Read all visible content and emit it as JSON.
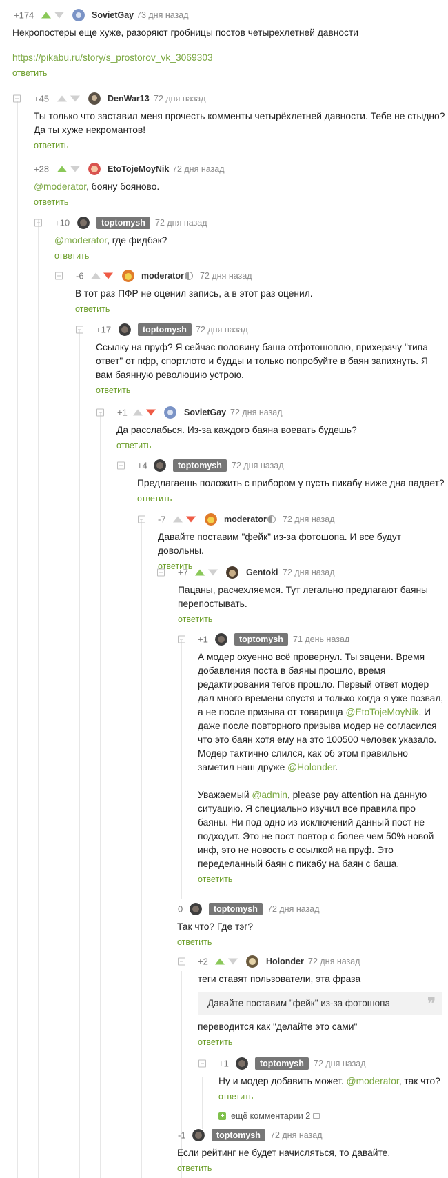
{
  "reply_label": "ответить",
  "comments": [
    {
      "id": "c1",
      "rating": "+174",
      "vote": "up",
      "user": "SovietGay",
      "time": "73 дня назад",
      "text_parts": [
        {
          "t": "Некропостеры еще хуже, разоряют гробницы постов четырехлетней давности"
        }
      ],
      "link": "https://pikabu.ru/story/s_prostorov_vk_3069303"
    },
    {
      "id": "c2",
      "rating": "+45",
      "vote": "none",
      "user": "DenWar13",
      "time": "72 дня назад",
      "text": "Ты только что заставил меня прочесть комменты четырёхлетней давности. Тебе не стыдно? Да ты хуже некромантов!"
    },
    {
      "id": "c3",
      "rating": "+28",
      "vote": "up",
      "user": "EtoTojeMoyNik",
      "time": "72 дня назад",
      "mention": "@moderator",
      "text_after": ",  бояну бояново."
    },
    {
      "id": "c4",
      "rating": "+10",
      "vote": "none",
      "user": "toptomysh",
      "time": "72 дня назад",
      "mention": "@moderator",
      "text_after": ", где фидбэк?"
    },
    {
      "id": "c5",
      "rating": "-6",
      "vote": "down",
      "user": "moderator",
      "time": "72 дня назад",
      "text": "В тот раз ПФР не оценил запись, а в этот раз оценил."
    },
    {
      "id": "c6",
      "rating": "+17",
      "vote": "none",
      "user": "toptomysh",
      "time": "72 дня назад",
      "text": "Ссылку на пруф? Я сейчас половину баша отфотошоплю, прихерачу \"типа ответ\" от пфр, спортлото и будды и только попробуйте в баян запихнуть. Я вам баянную революцию устрою."
    },
    {
      "id": "c7",
      "rating": "+1",
      "vote": "down",
      "user": "SovietGay",
      "time": "72 дня назад",
      "text": "Да расслабься. Из-за каждого баяна воевать будешь?"
    },
    {
      "id": "c8",
      "rating": "+4",
      "vote": "none",
      "user": "toptomysh",
      "time": "72 дня назад",
      "text": "Предлагаешь положить с прибором у пусть пикабу ниже дна падает?"
    },
    {
      "id": "c9",
      "rating": "-7",
      "vote": "down",
      "user": "moderator",
      "time": "72 дня назад",
      "text": "Давайте поставим \"фейк\" из-за фотошопа. И все будут довольны."
    },
    {
      "id": "c10",
      "rating": "+7",
      "vote": "up",
      "user": "Gentoki",
      "time": "72 дня назад",
      "text": "Пацаны, расчехляемся. Тут легально предлагают баяны перепостывать."
    },
    {
      "id": "c11",
      "rating": "+1",
      "vote": "none",
      "user": "toptomysh",
      "time": "71 день назад",
      "p1_a": "А модер охуенно всё провернул. Ты зацени. Время добавления поста в баяны прошло, время редактирования тегов прошло. Первый ответ модер дал много времени спустя и только когда я уже позвал, а не после призыва от товарища ",
      "p1_m1": "@EtoTojeMoyNik",
      "p1_b": ". И даже после повторного призыва модер не согласился что это баян хотя ему на это 100500 человек указало. Модер тактично слился, как об этом правильно заметил наш друже ",
      "p1_m2": "@Holonder",
      "p1_c": ".",
      "p2_a": "Уважаемый ",
      "p2_m": "@admin",
      "p2_b": ", please pay attention на данную ситуацию. Я специально изучил все правила про баяны. Ни под одно из исключений данный пост не подходит. Это не пост повтор с более чем 50% новой инф, это не новость с ссылкой на пруф. Это переделанный баян с пикабу на баян с баша."
    },
    {
      "id": "c12",
      "rating": "0",
      "vote": "none",
      "user": "toptomysh",
      "time": "72 дня назад",
      "text": "Так что? Где тэг?"
    },
    {
      "id": "c13",
      "rating": "+2",
      "vote": "up",
      "user": "Holonder",
      "time": "72 дня назад",
      "text": "теги ставят пользователи, эта фраза",
      "quote": "Давайте поставим \"фейк\" из-за фотошопа",
      "text2": "переводится как \"делайте это сами\""
    },
    {
      "id": "c14",
      "rating": "+1",
      "vote": "none",
      "user": "toptomysh",
      "time": "72 дня назад",
      "text_before": "Ну и модер добавить может. ",
      "mention": "@moderator",
      "text_after": ", так что?"
    },
    {
      "id": "c15",
      "rating": "-1",
      "vote": "none",
      "user": "toptomysh",
      "time": "72 дня назад",
      "text": "Если рейтинг не будет начисляться, то давайте."
    }
  ],
  "more_comments": "ещё комментарии 2",
  "colors": {
    "link": "#6c9e2a",
    "up": "#8ac858",
    "down": "#ef5b46",
    "badge": "#777777"
  }
}
